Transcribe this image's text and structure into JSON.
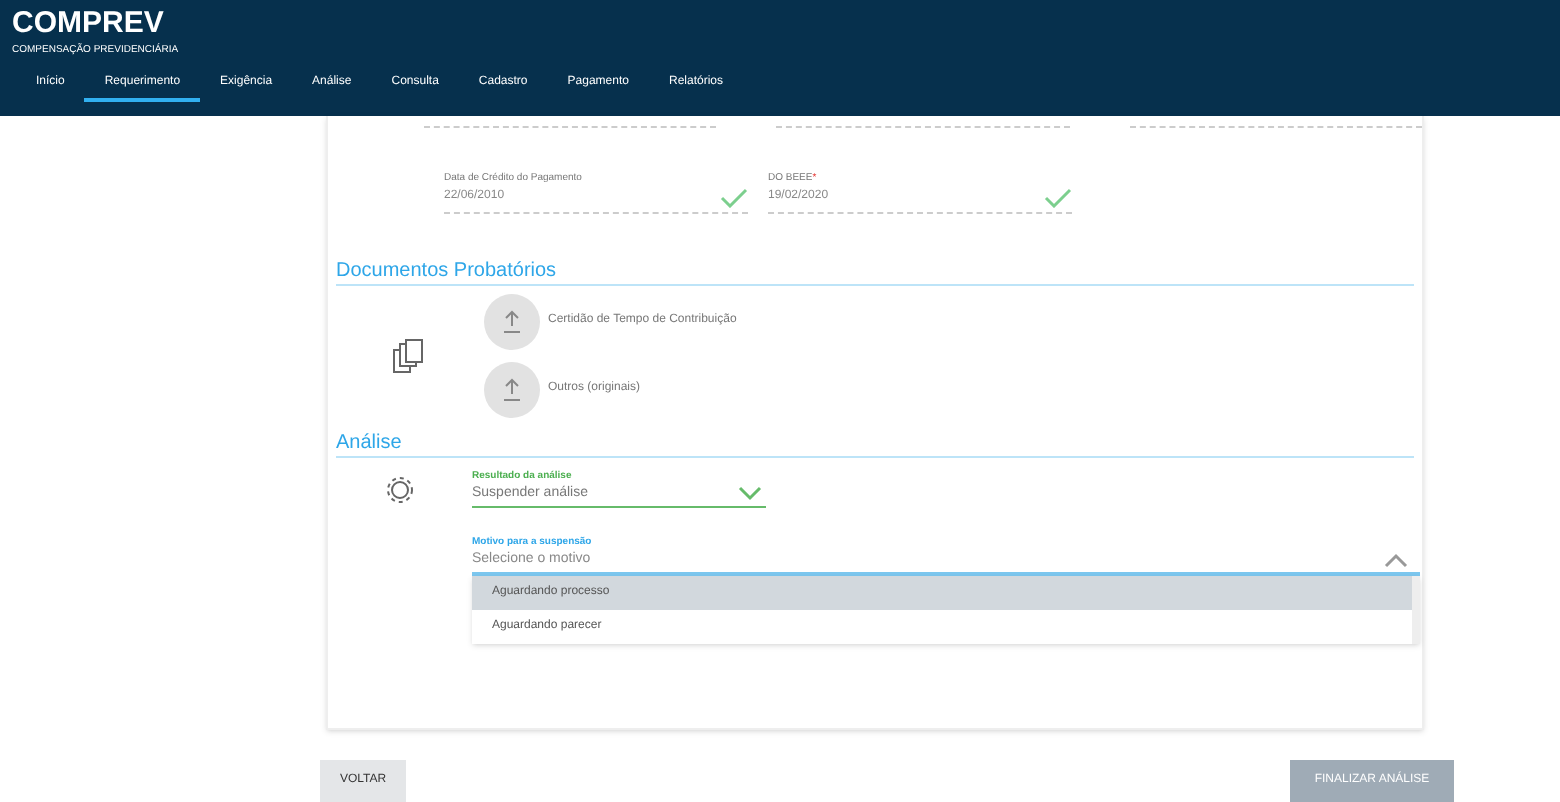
{
  "header": {
    "logo": "COMPREV",
    "subtitle": "COMPENSAÇÃO PREVIDENCIÁRIA"
  },
  "nav": [
    {
      "label": "Início",
      "selected": false
    },
    {
      "label": "Requerimento",
      "selected": true
    },
    {
      "label": "Exigência",
      "selected": false
    },
    {
      "label": "Análise",
      "selected": false
    },
    {
      "label": "Consulta",
      "selected": false
    },
    {
      "label": "Cadastro",
      "selected": false
    },
    {
      "label": "Pagamento",
      "selected": false
    },
    {
      "label": "Relatórios",
      "selected": false
    }
  ],
  "fields": [
    {
      "label": "Data de Crédito do Pagamento",
      "value": "22/06/2010",
      "valid": true
    },
    {
      "label": "DO BEEE",
      "value": "19/02/2020",
      "required_mark": "*",
      "valid": true
    }
  ],
  "documents": {
    "title": "Documentos Probatórios",
    "items": [
      {
        "label": "Certidão de Tempo de Contribuição"
      },
      {
        "label": "Outros (originais)"
      }
    ]
  },
  "analysis": {
    "title": "Análise",
    "result": {
      "label": "Resultado da análise",
      "value": "Suspender análise"
    },
    "reason": {
      "label": "Motivo para a suspensão",
      "placeholder": "Selecione o motivo",
      "expanded": true,
      "options": [
        {
          "label": "Aguardando processo",
          "selected": true
        },
        {
          "label": "Aguardando parecer",
          "selected": false
        }
      ]
    }
  },
  "buttons": [
    {
      "label": "VOLTAR",
      "disabled": false
    },
    {
      "label": "FINALIZAR ANÁLISE",
      "disabled": true
    }
  ]
}
